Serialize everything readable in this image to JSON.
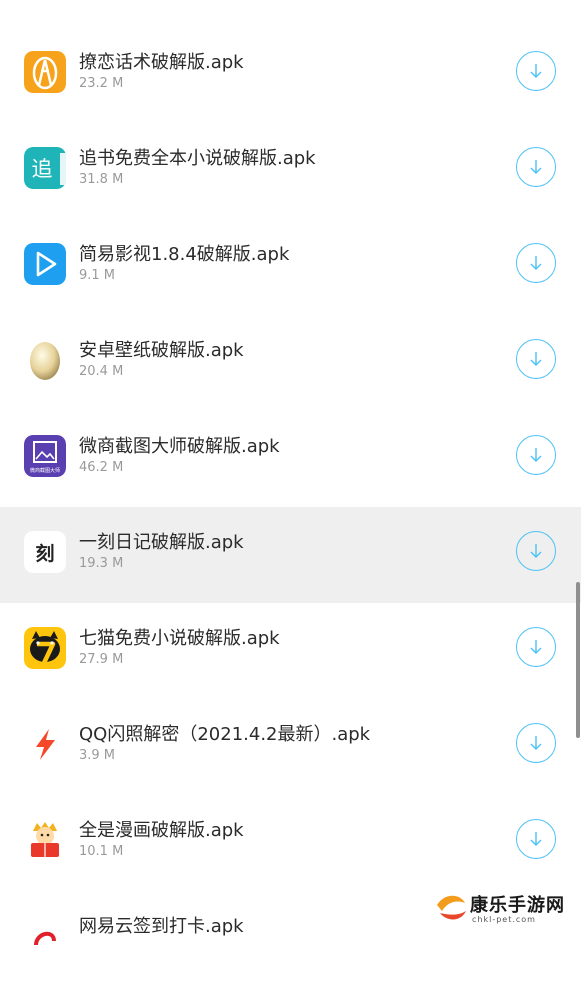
{
  "download_list": {
    "items": [
      {
        "name": "撩恋话术破解版.apk",
        "size": "23.2 M",
        "icon": "orange-figure-app-icon"
      },
      {
        "name": "追书免费全本小说破解版.apk",
        "size": "31.8 M",
        "icon": "zhui-app-icon"
      },
      {
        "name": "简易影视1.8.4破解版.apk",
        "size": "9.1 M",
        "icon": "play-app-icon"
      },
      {
        "name": "安卓壁纸破解版.apk",
        "size": "20.4 M",
        "icon": "egg-app-icon"
      },
      {
        "name": "微商截图大师破解版.apk",
        "size": "46.2 M",
        "icon": "screenshot-app-icon"
      },
      {
        "name": "一刻日记破解版.apk",
        "size": "19.3 M",
        "icon": "ke-app-icon"
      },
      {
        "name": "七猫免费小说破解版.apk",
        "size": "27.9 M",
        "icon": "qimao-cat-app-icon"
      },
      {
        "name": "QQ闪照解密（2021.4.2最新）.apk",
        "size": "3.9 M",
        "icon": "lightning-app-icon"
      },
      {
        "name": "全是漫画破解版.apk",
        "size": "10.1 M",
        "icon": "comic-reader-app-icon"
      },
      {
        "name": "网易云签到打卡.apk",
        "size": "",
        "icon": "netease-app-icon"
      }
    ],
    "highlighted_index": 5
  },
  "icon_text": {
    "zhui": "追",
    "ke": "刻",
    "screenshot_caption": "微商截图大师"
  },
  "watermark": {
    "title": "康乐手游网",
    "subtitle": "chkl-pet.com"
  },
  "colors": {
    "accent": "#4cc3f2",
    "highlight_row": "#efefef",
    "title_text": "#2b2b2b",
    "size_text": "#9a9a9a"
  }
}
